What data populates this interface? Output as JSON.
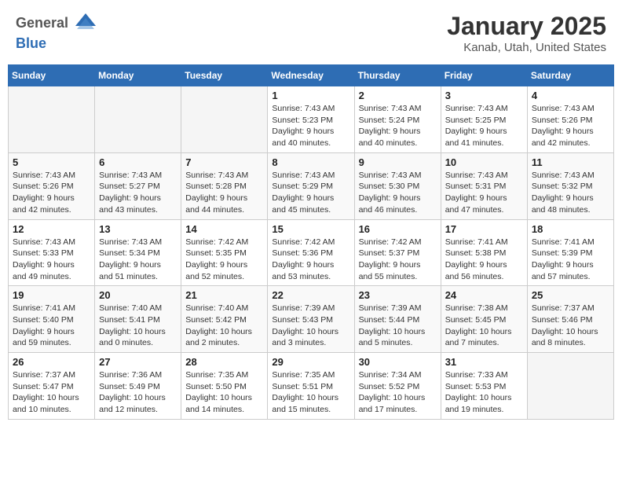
{
  "header": {
    "logo_line1": "General",
    "logo_line2": "Blue",
    "title": "January 2025",
    "subtitle": "Kanab, Utah, United States"
  },
  "calendar": {
    "headers": [
      "Sunday",
      "Monday",
      "Tuesday",
      "Wednesday",
      "Thursday",
      "Friday",
      "Saturday"
    ],
    "weeks": [
      [
        {
          "num": "",
          "sunrise": "",
          "sunset": "",
          "daylight": "",
          "empty": true
        },
        {
          "num": "",
          "sunrise": "",
          "sunset": "",
          "daylight": "",
          "empty": true
        },
        {
          "num": "",
          "sunrise": "",
          "sunset": "",
          "daylight": "",
          "empty": true
        },
        {
          "num": "1",
          "sunrise": "Sunrise: 7:43 AM",
          "sunset": "Sunset: 5:23 PM",
          "daylight": "Daylight: 9 hours and 40 minutes."
        },
        {
          "num": "2",
          "sunrise": "Sunrise: 7:43 AM",
          "sunset": "Sunset: 5:24 PM",
          "daylight": "Daylight: 9 hours and 40 minutes."
        },
        {
          "num": "3",
          "sunrise": "Sunrise: 7:43 AM",
          "sunset": "Sunset: 5:25 PM",
          "daylight": "Daylight: 9 hours and 41 minutes."
        },
        {
          "num": "4",
          "sunrise": "Sunrise: 7:43 AM",
          "sunset": "Sunset: 5:26 PM",
          "daylight": "Daylight: 9 hours and 42 minutes."
        }
      ],
      [
        {
          "num": "5",
          "sunrise": "Sunrise: 7:43 AM",
          "sunset": "Sunset: 5:26 PM",
          "daylight": "Daylight: 9 hours and 42 minutes."
        },
        {
          "num": "6",
          "sunrise": "Sunrise: 7:43 AM",
          "sunset": "Sunset: 5:27 PM",
          "daylight": "Daylight: 9 hours and 43 minutes."
        },
        {
          "num": "7",
          "sunrise": "Sunrise: 7:43 AM",
          "sunset": "Sunset: 5:28 PM",
          "daylight": "Daylight: 9 hours and 44 minutes."
        },
        {
          "num": "8",
          "sunrise": "Sunrise: 7:43 AM",
          "sunset": "Sunset: 5:29 PM",
          "daylight": "Daylight: 9 hours and 45 minutes."
        },
        {
          "num": "9",
          "sunrise": "Sunrise: 7:43 AM",
          "sunset": "Sunset: 5:30 PM",
          "daylight": "Daylight: 9 hours and 46 minutes."
        },
        {
          "num": "10",
          "sunrise": "Sunrise: 7:43 AM",
          "sunset": "Sunset: 5:31 PM",
          "daylight": "Daylight: 9 hours and 47 minutes."
        },
        {
          "num": "11",
          "sunrise": "Sunrise: 7:43 AM",
          "sunset": "Sunset: 5:32 PM",
          "daylight": "Daylight: 9 hours and 48 minutes."
        }
      ],
      [
        {
          "num": "12",
          "sunrise": "Sunrise: 7:43 AM",
          "sunset": "Sunset: 5:33 PM",
          "daylight": "Daylight: 9 hours and 49 minutes."
        },
        {
          "num": "13",
          "sunrise": "Sunrise: 7:43 AM",
          "sunset": "Sunset: 5:34 PM",
          "daylight": "Daylight: 9 hours and 51 minutes."
        },
        {
          "num": "14",
          "sunrise": "Sunrise: 7:42 AM",
          "sunset": "Sunset: 5:35 PM",
          "daylight": "Daylight: 9 hours and 52 minutes."
        },
        {
          "num": "15",
          "sunrise": "Sunrise: 7:42 AM",
          "sunset": "Sunset: 5:36 PM",
          "daylight": "Daylight: 9 hours and 53 minutes."
        },
        {
          "num": "16",
          "sunrise": "Sunrise: 7:42 AM",
          "sunset": "Sunset: 5:37 PM",
          "daylight": "Daylight: 9 hours and 55 minutes."
        },
        {
          "num": "17",
          "sunrise": "Sunrise: 7:41 AM",
          "sunset": "Sunset: 5:38 PM",
          "daylight": "Daylight: 9 hours and 56 minutes."
        },
        {
          "num": "18",
          "sunrise": "Sunrise: 7:41 AM",
          "sunset": "Sunset: 5:39 PM",
          "daylight": "Daylight: 9 hours and 57 minutes."
        }
      ],
      [
        {
          "num": "19",
          "sunrise": "Sunrise: 7:41 AM",
          "sunset": "Sunset: 5:40 PM",
          "daylight": "Daylight: 9 hours and 59 minutes."
        },
        {
          "num": "20",
          "sunrise": "Sunrise: 7:40 AM",
          "sunset": "Sunset: 5:41 PM",
          "daylight": "Daylight: 10 hours and 0 minutes."
        },
        {
          "num": "21",
          "sunrise": "Sunrise: 7:40 AM",
          "sunset": "Sunset: 5:42 PM",
          "daylight": "Daylight: 10 hours and 2 minutes."
        },
        {
          "num": "22",
          "sunrise": "Sunrise: 7:39 AM",
          "sunset": "Sunset: 5:43 PM",
          "daylight": "Daylight: 10 hours and 3 minutes."
        },
        {
          "num": "23",
          "sunrise": "Sunrise: 7:39 AM",
          "sunset": "Sunset: 5:44 PM",
          "daylight": "Daylight: 10 hours and 5 minutes."
        },
        {
          "num": "24",
          "sunrise": "Sunrise: 7:38 AM",
          "sunset": "Sunset: 5:45 PM",
          "daylight": "Daylight: 10 hours and 7 minutes."
        },
        {
          "num": "25",
          "sunrise": "Sunrise: 7:37 AM",
          "sunset": "Sunset: 5:46 PM",
          "daylight": "Daylight: 10 hours and 8 minutes."
        }
      ],
      [
        {
          "num": "26",
          "sunrise": "Sunrise: 7:37 AM",
          "sunset": "Sunset: 5:47 PM",
          "daylight": "Daylight: 10 hours and 10 minutes."
        },
        {
          "num": "27",
          "sunrise": "Sunrise: 7:36 AM",
          "sunset": "Sunset: 5:49 PM",
          "daylight": "Daylight: 10 hours and 12 minutes."
        },
        {
          "num": "28",
          "sunrise": "Sunrise: 7:35 AM",
          "sunset": "Sunset: 5:50 PM",
          "daylight": "Daylight: 10 hours and 14 minutes."
        },
        {
          "num": "29",
          "sunrise": "Sunrise: 7:35 AM",
          "sunset": "Sunset: 5:51 PM",
          "daylight": "Daylight: 10 hours and 15 minutes."
        },
        {
          "num": "30",
          "sunrise": "Sunrise: 7:34 AM",
          "sunset": "Sunset: 5:52 PM",
          "daylight": "Daylight: 10 hours and 17 minutes."
        },
        {
          "num": "31",
          "sunrise": "Sunrise: 7:33 AM",
          "sunset": "Sunset: 5:53 PM",
          "daylight": "Daylight: 10 hours and 19 minutes."
        },
        {
          "num": "",
          "sunrise": "",
          "sunset": "",
          "daylight": "",
          "empty": true
        }
      ]
    ]
  }
}
